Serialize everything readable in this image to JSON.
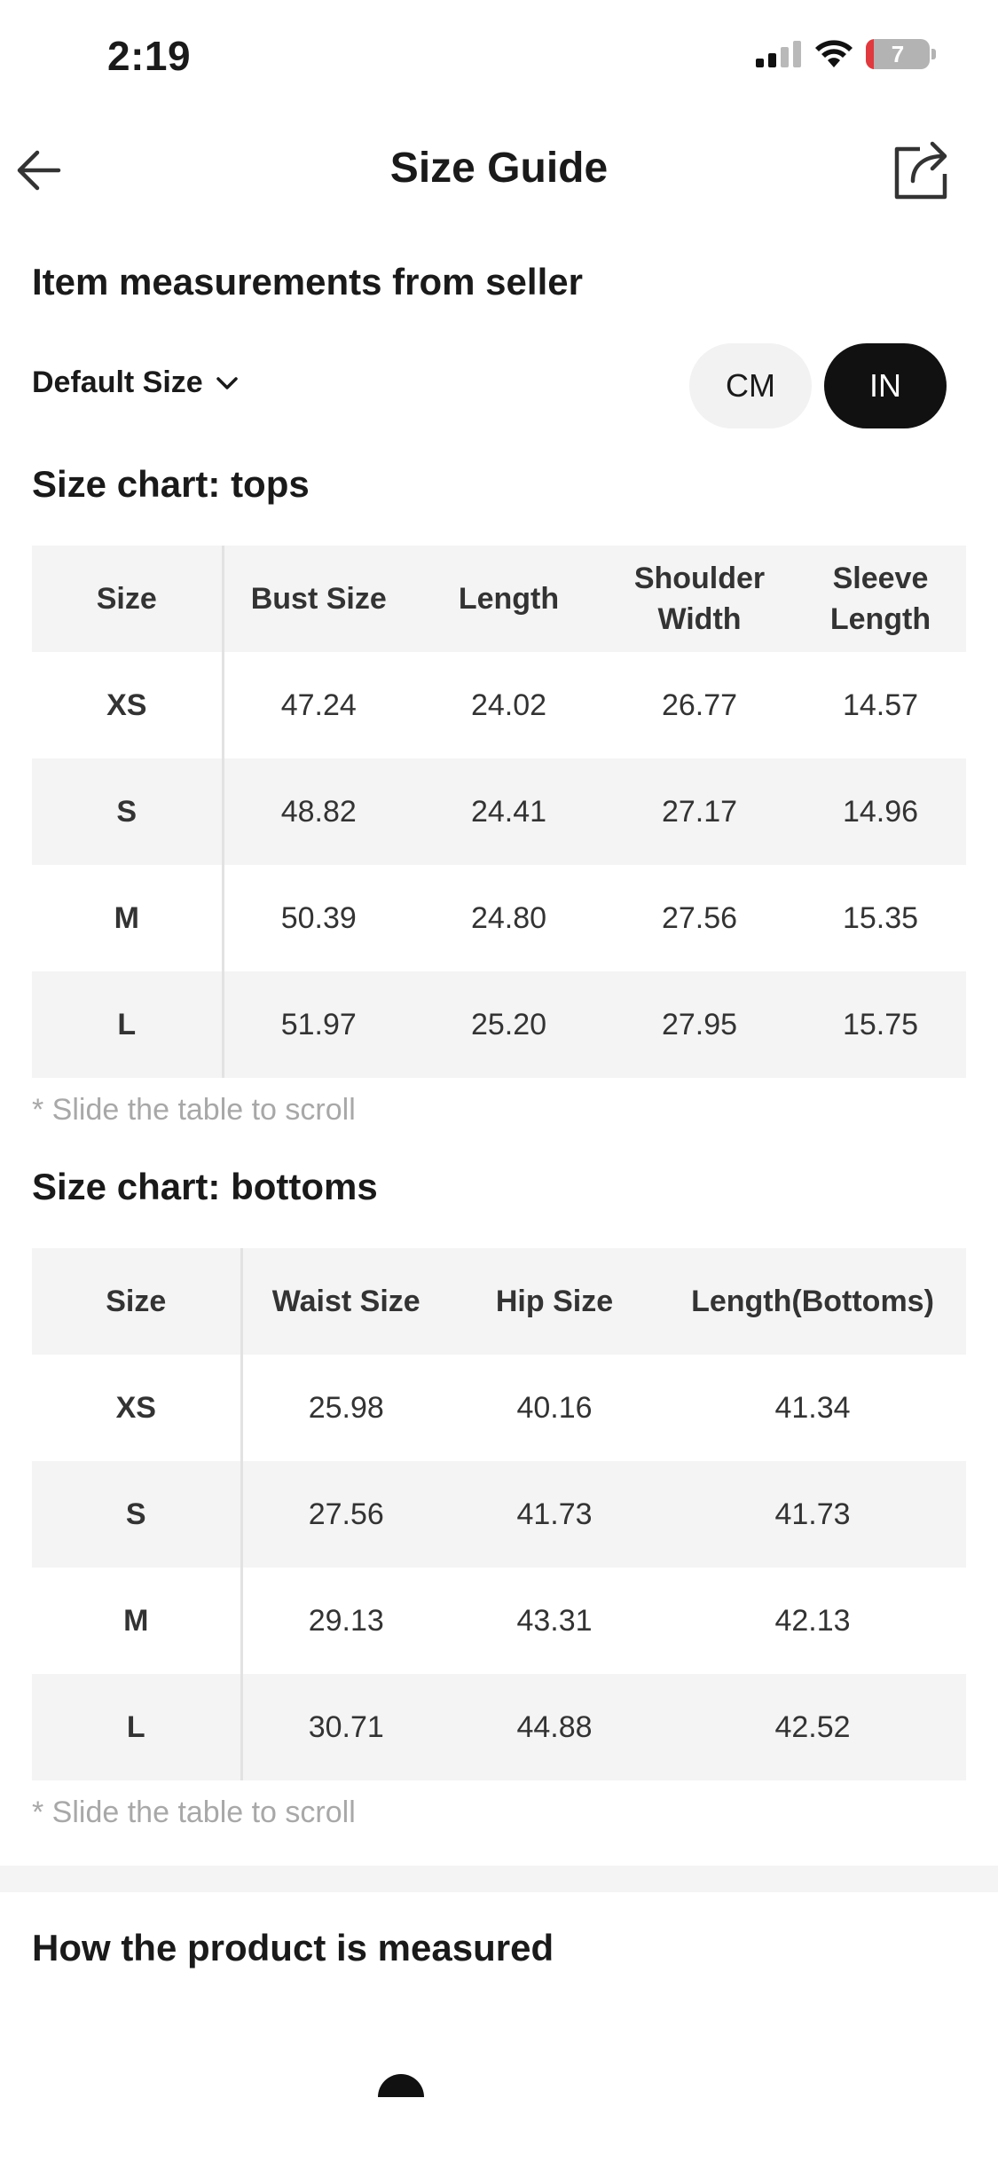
{
  "status_bar": {
    "time": "2:19",
    "battery_level": "7"
  },
  "nav": {
    "title": "Size Guide"
  },
  "main": {
    "heading": "Item measurements from seller",
    "default_size_label": "Default Size",
    "units": {
      "cm": "CM",
      "in": "IN",
      "selected": "IN"
    }
  },
  "tops": {
    "title": "Size chart: tops",
    "headers": [
      "Size",
      "Bust Size",
      "Length",
      "Shoulder Width",
      "Sleeve Length"
    ],
    "rows": [
      [
        "XS",
        "47.24",
        "24.02",
        "26.77",
        "14.57"
      ],
      [
        "S",
        "48.82",
        "24.41",
        "27.17",
        "14.96"
      ],
      [
        "M",
        "50.39",
        "24.80",
        "27.56",
        "15.35"
      ],
      [
        "L",
        "51.97",
        "25.20",
        "27.95",
        "15.75"
      ]
    ],
    "hint": "* Slide the table to scroll"
  },
  "bottoms": {
    "title": "Size chart: bottoms",
    "headers": [
      "Size",
      "Waist Size",
      "Hip Size",
      "Length(Bottoms)"
    ],
    "rows": [
      [
        "XS",
        "25.98",
        "40.16",
        "41.34"
      ],
      [
        "S",
        "27.56",
        "41.73",
        "41.73"
      ],
      [
        "M",
        "29.13",
        "43.31",
        "42.13"
      ],
      [
        "L",
        "30.71",
        "44.88",
        "42.52"
      ]
    ],
    "hint": "* Slide the table to scroll"
  },
  "measure": {
    "title": "How the product is measured"
  }
}
